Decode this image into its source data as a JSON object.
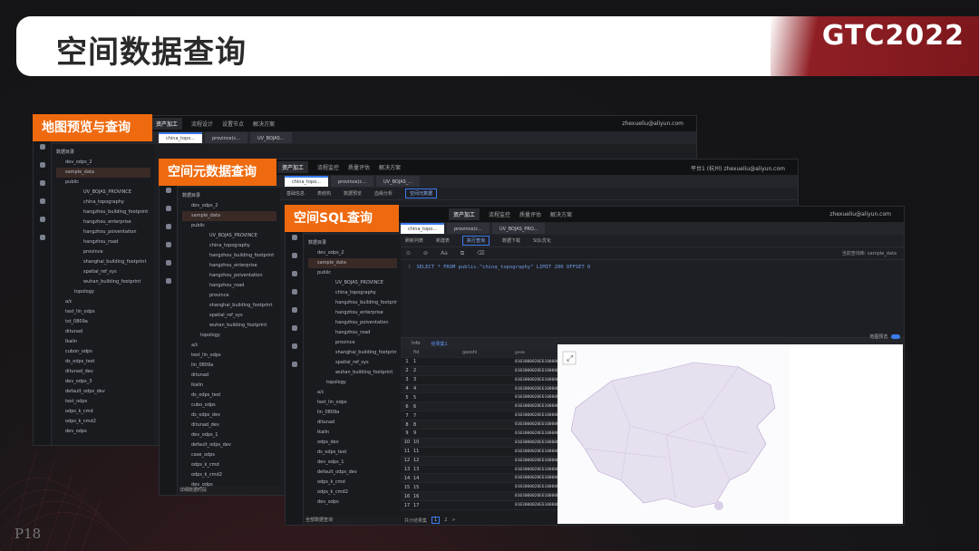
{
  "slide": {
    "title": "空间数据查询",
    "brand": "GTC2022",
    "page_number": "P18"
  },
  "badges": {
    "map_preview": "地图预览与查询",
    "metadata": "空间元数据查询",
    "sql": "空间SQL查询"
  },
  "colors": {
    "accent": "#ef6a0f",
    "brand_red": "#8f1f25",
    "link_blue": "#3c7bf0"
  },
  "window1": {
    "top_menu": [
      "资产加工",
      "流程设计",
      "设置节点",
      "解决方案"
    ],
    "account": "zhexueliu@aliyun.com",
    "tabs": [
      "china_topo...",
      "province(c...",
      "UV_BOJAS..."
    ],
    "tree": [
      "数据目录",
      "dev_odps_2",
      "sample_data",
      "public",
      "UV_BOJAS_PROVINCE",
      "china_topography",
      "hangzhou_building_footprint",
      "hangzhou_enterprise",
      "hangzhou_poiventation",
      "hangzhou_road",
      "province",
      "shanghai_building_footprint",
      "spatial_ref_sys",
      "wuhan_building_footprint",
      "topology",
      "a/c",
      "test_lin_odps",
      "tst_0809a",
      "ditunad",
      "lkalin",
      "cubon_odps",
      "ds_odps_test",
      "ditunad_dev",
      "dev_odps_3",
      "default_odps_dev",
      "test_odps",
      "odps_k_cmd",
      "odps_k_cmd2",
      "dev_odps"
    ]
  },
  "window2": {
    "top_menu": [
      "资产加工",
      "流程监控",
      "质量评估",
      "解决方案"
    ],
    "account": "zhexueliu@aliyun.com",
    "account_prefix": "平台1 (杭州)",
    "tabs": [
      "china_topo...",
      "province(c...",
      "UV_BOJAS_..."
    ],
    "tools": [
      "基础信息",
      "表结构",
      "数据预览",
      "血缘分析",
      "空间元数据"
    ],
    "tree": [
      "数据目录",
      "dev_odps_2",
      "sample_data",
      "public",
      "UV_BOJAS_PROVINCE",
      "china_topography",
      "hangzhou_building_footprint",
      "hangzhou_enterprise",
      "hangzhou_poiventation",
      "hangzhou_road",
      "province",
      "shanghai_building_footprint",
      "spatial_ref_sys",
      "wuhan_building_footprint",
      "topology",
      "a/c",
      "test_lin_odps",
      "lin_0809a",
      "ditunad",
      "lkalin",
      "ds_odps_test",
      "cubo_odps",
      "ds_odps_dev",
      "ditunad_dev",
      "dev_odps_1",
      "default_odps_dev",
      "case_odps",
      "odps_k_cmd",
      "odps_k_cmd2",
      "dev_odps"
    ],
    "footer": "详细数据时段"
  },
  "window3": {
    "top_menu": [
      "资产加工",
      "流程监控",
      "质量评估",
      "解决方案"
    ],
    "account": "zhexueliu@aliyun.com",
    "tabs": [
      "china_topo...",
      "province(c...",
      "UV_BOJAS_PRO..."
    ],
    "tools": [
      "刷新列表",
      "新建表",
      "执行查询",
      "数据下载",
      "SQL优化"
    ],
    "editor_right": "当前查询库: sample_data",
    "sql": "SELECT * FROM public.\"china_topography\" LIMIT 200 OFFSET 0",
    "tree": [
      "数据目录",
      "dev_odps_2",
      "sample_data",
      "public",
      "UV_BOJAS_PROVINCE",
      "china_topography",
      "hangzhou_building_footprint",
      "hangzhou_enterprise",
      "hangzhou_poiventation",
      "hangzhou_road",
      "province",
      "shanghai_building_footprint",
      "spatial_ref_sys",
      "wuhan_building_footprint",
      "topology",
      "a/c",
      "test_lin_odps",
      "lin_0809a",
      "ditunad",
      "lkalin",
      "odps_dev",
      "ds_odps_test",
      "dev_odps_1",
      "default_odps_dev",
      "odps_k_cmd",
      "odps_k_cmd2",
      "dev_odps"
    ],
    "result_tabs": [
      "Info",
      "结果集1"
    ],
    "map_toggle": "地图预览",
    "columns": [
      "",
      "fid",
      "gaoshi",
      "geom",
      "type"
    ],
    "rows": [
      [
        "1",
        "1",
        "",
        "0103000020E6100000...",
        "0"
      ],
      [
        "2",
        "2",
        "",
        "0103000020E6100000...",
        "0"
      ],
      [
        "3",
        "3",
        "",
        "0103000020E6100000...",
        "0"
      ],
      [
        "4",
        "4",
        "",
        "0103000020E6100000...",
        "0"
      ],
      [
        "5",
        "5",
        "",
        "0103000020E6100000...",
        "0"
      ],
      [
        "6",
        "6",
        "",
        "0103000020E6100000...",
        "0"
      ],
      [
        "7",
        "7",
        "",
        "0103000020E6100000...",
        "0"
      ],
      [
        "8",
        "8",
        "",
        "0103000020E6100000...",
        "0"
      ],
      [
        "9",
        "9",
        "",
        "0103000020E6100000...",
        "0"
      ],
      [
        "10",
        "10",
        "",
        "0103000020E6100000...",
        "0"
      ],
      [
        "11",
        "11",
        "",
        "0103000020E6100000...",
        "0"
      ],
      [
        "12",
        "12",
        "",
        "0103000020E6100000...",
        "0"
      ],
      [
        "13",
        "13",
        "",
        "0103000020E6100000...",
        "0"
      ],
      [
        "14",
        "14",
        "",
        "0103000020E6100000...",
        "0"
      ],
      [
        "15",
        "15",
        "",
        "0103000020E6100000...",
        "0"
      ],
      [
        "16",
        "16",
        "",
        "0103000020E6100000...",
        "0"
      ],
      [
        "17",
        "17",
        "",
        "0103000020E6100000...",
        "0"
      ]
    ],
    "pager": [
      "共计结果集",
      "1",
      "2",
      ">"
    ],
    "footer": "全部数据查询"
  }
}
